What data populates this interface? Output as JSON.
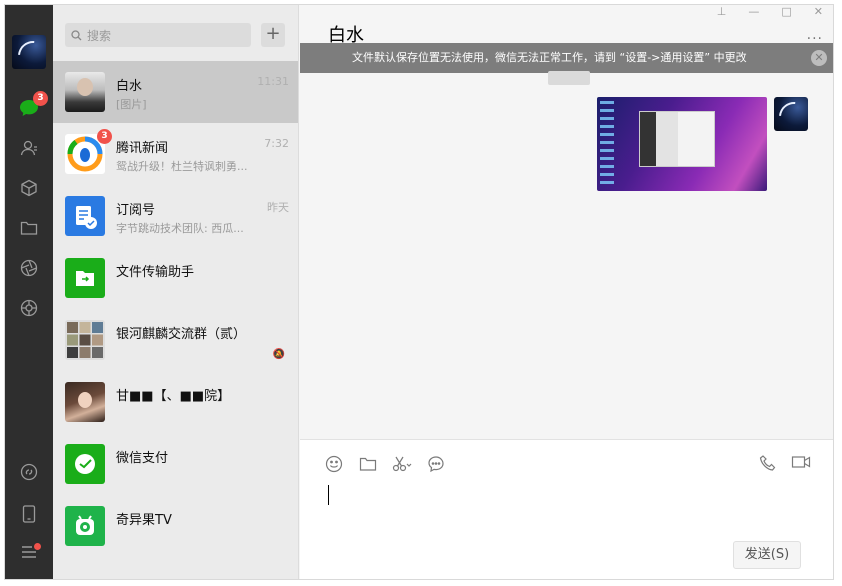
{
  "sidebar": {
    "chat_badge": "3"
  },
  "search": {
    "placeholder": "搜索"
  },
  "add_label": "+",
  "chats": [
    {
      "name": "白水",
      "preview": "[图片]",
      "time": "11:31",
      "active": true
    },
    {
      "name": "腾讯新闻",
      "preview": "鸳战升级！杜兰特讽刺勇...",
      "time": "7:32",
      "badge": "3"
    },
    {
      "name": "订阅号",
      "preview": "字节跳动技术团队: 西瓜...",
      "time": "昨天"
    },
    {
      "name": "文件传输助手",
      "preview": "",
      "time": ""
    },
    {
      "name": "银河麒麟交流群（贰）",
      "preview": "",
      "time": ""
    },
    {
      "name": "甘■■【、■■院】",
      "preview": "",
      "time": ""
    },
    {
      "name": "微信支付",
      "preview": "",
      "time": ""
    },
    {
      "name": "奇异果TV",
      "preview": "",
      "time": ""
    }
  ],
  "conversation": {
    "title": "白水",
    "more": "···",
    "banner": "文件默认保存位置无法使用，微信无法正常工作，请到 “设置->通用设置” 中更改",
    "send_label": "发送(S)"
  },
  "window_controls": {
    "pin": "⊥",
    "minimize": "—",
    "maximize": "□",
    "close": "✕"
  },
  "colors": {
    "accent": "#1aad19",
    "badge": "#f1524b",
    "rail": "#2e2e2e",
    "list_bg": "#ebebeb"
  }
}
